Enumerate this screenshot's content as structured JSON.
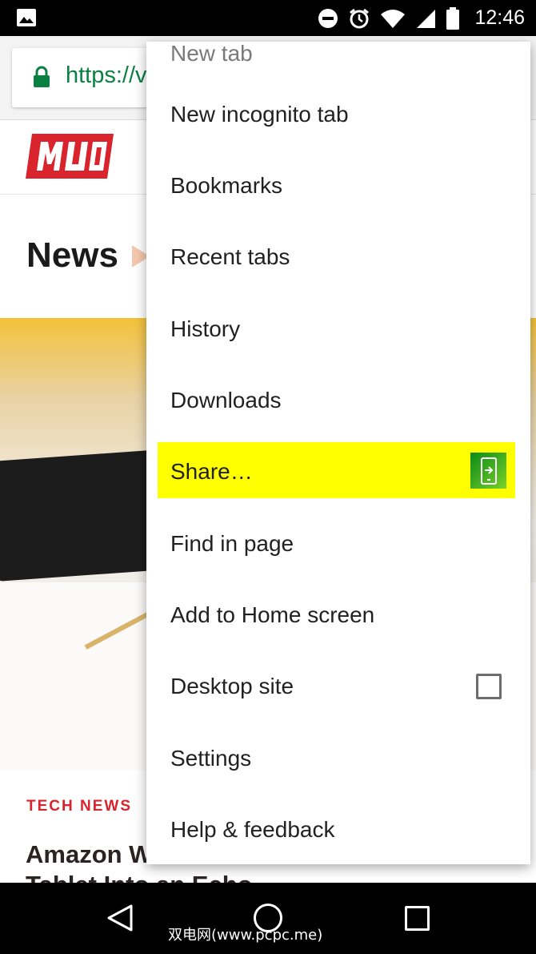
{
  "status_bar": {
    "time": "12:46",
    "icons": [
      "image-icon",
      "do-not-disturb-icon",
      "alarm-icon",
      "wifi-icon",
      "cell-signal-icon",
      "battery-icon"
    ]
  },
  "url_bar": {
    "url_visible": "https://v"
  },
  "page": {
    "logo_text": "MUO",
    "section_title": "News",
    "tag": "TECH NEWS",
    "headline": "Amazon W",
    "headline_line2": "Tablet Into an Echo"
  },
  "menu": {
    "items": [
      {
        "label": "New tab"
      },
      {
        "label": "New incognito tab"
      },
      {
        "label": "Bookmarks"
      },
      {
        "label": "Recent tabs"
      },
      {
        "label": "History"
      },
      {
        "label": "Downloads"
      },
      {
        "label": "Share…"
      },
      {
        "label": "Find in page"
      },
      {
        "label": "Add to Home screen"
      },
      {
        "label": "Desktop site"
      },
      {
        "label": "Settings"
      },
      {
        "label": "Help & feedback"
      }
    ],
    "highlight_color": "#ffff00"
  },
  "watermark": "双电网(www.pcpc.me)",
  "colors": {
    "url_green": "#0b8043",
    "brand_red": "#d9232d"
  }
}
